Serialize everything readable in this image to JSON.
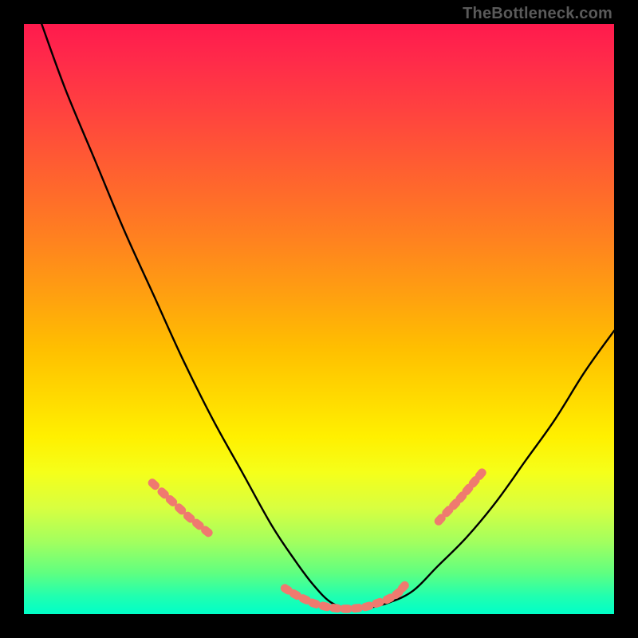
{
  "watermark": "TheBottleneck.com",
  "colors": {
    "frame": "#000000",
    "watermark": "#5a5a5a",
    "curve": "#000000",
    "marker_fill": "#ef7a6f",
    "marker_stroke": "#ef7a6f",
    "gradient_top": "#ff1a4d",
    "gradient_bottom": "#00ffc8"
  },
  "chart_data": {
    "type": "line",
    "title": "",
    "xlabel": "",
    "ylabel": "",
    "xlim": [
      0,
      100
    ],
    "ylim": [
      0,
      100
    ],
    "grid": false,
    "series": [
      {
        "name": "bottleneck-curve",
        "x": [
          3,
          7,
          12,
          17,
          22,
          27,
          32,
          37,
          42,
          46,
          49,
          52,
          55,
          58,
          62,
          66,
          70,
          75,
          80,
          85,
          90,
          95,
          100
        ],
        "y": [
          100,
          89,
          77,
          65,
          54,
          43,
          33,
          24,
          15,
          9,
          5,
          2,
          1,
          1,
          2,
          4,
          8,
          13,
          19,
          26,
          33,
          41,
          48
        ]
      }
    ],
    "markers": [
      {
        "name": "left-cluster",
        "shape": "rounded",
        "points": [
          {
            "x": 22,
            "y": 22
          },
          {
            "x": 23.6,
            "y": 20.5
          },
          {
            "x": 25,
            "y": 19.2
          },
          {
            "x": 26.5,
            "y": 17.8
          },
          {
            "x": 28,
            "y": 16.4
          },
          {
            "x": 29.5,
            "y": 15.2
          },
          {
            "x": 31,
            "y": 14
          }
        ]
      },
      {
        "name": "bottom-cluster",
        "shape": "rounded",
        "points": [
          {
            "x": 44.5,
            "y": 4.2
          },
          {
            "x": 46,
            "y": 3.3
          },
          {
            "x": 47.6,
            "y": 2.5
          },
          {
            "x": 49.2,
            "y": 1.8
          },
          {
            "x": 51,
            "y": 1.3
          },
          {
            "x": 52.8,
            "y": 1.0
          },
          {
            "x": 54.6,
            "y": 0.9
          },
          {
            "x": 56.4,
            "y": 1.0
          },
          {
            "x": 58.2,
            "y": 1.3
          },
          {
            "x": 60,
            "y": 1.9
          },
          {
            "x": 61.8,
            "y": 2.6
          },
          {
            "x": 63.3,
            "y": 3.5
          },
          {
            "x": 64.3,
            "y": 4.6
          }
        ]
      },
      {
        "name": "right-cluster",
        "shape": "rounded",
        "points": [
          {
            "x": 70.5,
            "y": 16
          },
          {
            "x": 71.8,
            "y": 17.4
          },
          {
            "x": 73,
            "y": 18.6
          },
          {
            "x": 74.1,
            "y": 19.8
          },
          {
            "x": 75.2,
            "y": 21.1
          },
          {
            "x": 76.3,
            "y": 22.4
          },
          {
            "x": 77.4,
            "y": 23.7
          }
        ]
      }
    ]
  }
}
